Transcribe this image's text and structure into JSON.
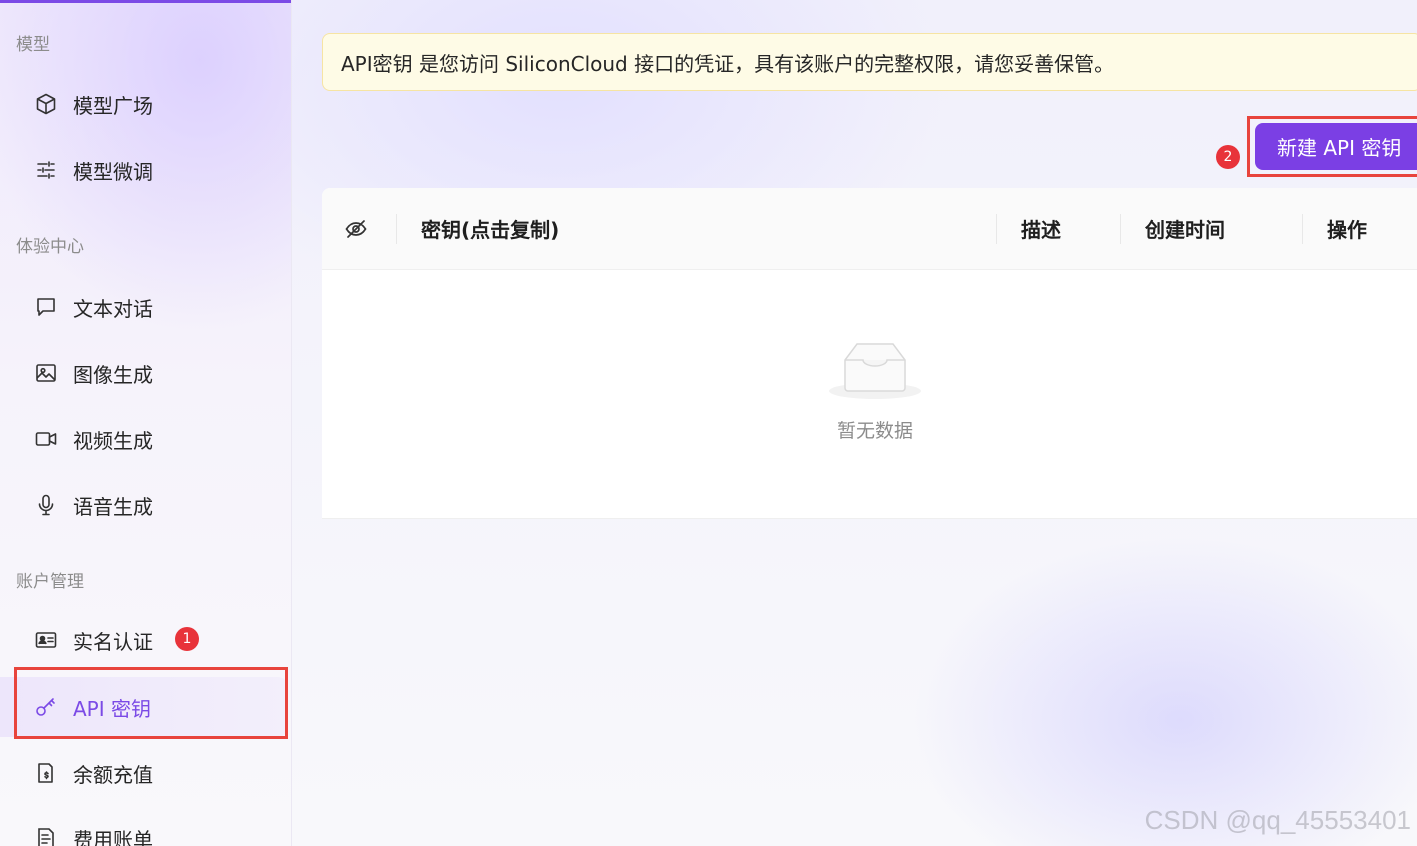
{
  "sidebar": {
    "sections": [
      {
        "title": "模型"
      },
      {
        "title": "体验中心"
      },
      {
        "title": "账户管理"
      }
    ],
    "items": [
      {
        "label": "模型广场",
        "icon": "cube-icon"
      },
      {
        "label": "模型微调",
        "icon": "sliders-icon"
      },
      {
        "label": "文本对话",
        "icon": "chat-icon"
      },
      {
        "label": "图像生成",
        "icon": "image-icon"
      },
      {
        "label": "视频生成",
        "icon": "video-icon"
      },
      {
        "label": "语音生成",
        "icon": "microphone-icon"
      },
      {
        "label": "实名认证",
        "icon": "id-card-icon"
      },
      {
        "label": "API 密钥",
        "icon": "key-icon",
        "active": true
      },
      {
        "label": "余额充值",
        "icon": "wallet-icon"
      },
      {
        "label": "费用账单",
        "icon": "bill-icon"
      }
    ],
    "accent_color": "#7b4ae6"
  },
  "annotations": {
    "badge_1": "1",
    "badge_2": "2"
  },
  "notice": {
    "text": "API密钥 是您访问 SiliconCloud 接口的凭证，具有该账户的完整权限，请您妥善保管。"
  },
  "toolbar": {
    "new_key_label": "新建 API 密钥"
  },
  "table": {
    "columns": [
      {
        "label": "密钥(点击复制)"
      },
      {
        "label": "描述"
      },
      {
        "label": "创建时间"
      },
      {
        "label": "操作"
      }
    ],
    "rows": [],
    "empty_text": "暂无数据"
  },
  "watermark": "CSDN @qq_45553401"
}
